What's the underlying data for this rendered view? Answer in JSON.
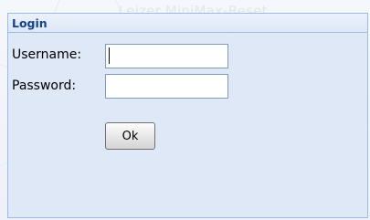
{
  "background": {
    "watermark_text": "Leizer MiniMax-Reset"
  },
  "login": {
    "title": "Login",
    "username_label": "Username:",
    "username_value": "",
    "password_label": "Password:",
    "password_value": "",
    "ok_label": "Ok"
  },
  "colors": {
    "panel_background": "#dfe8f6",
    "panel_border": "#99bbe8",
    "title_text": "#15428b"
  }
}
